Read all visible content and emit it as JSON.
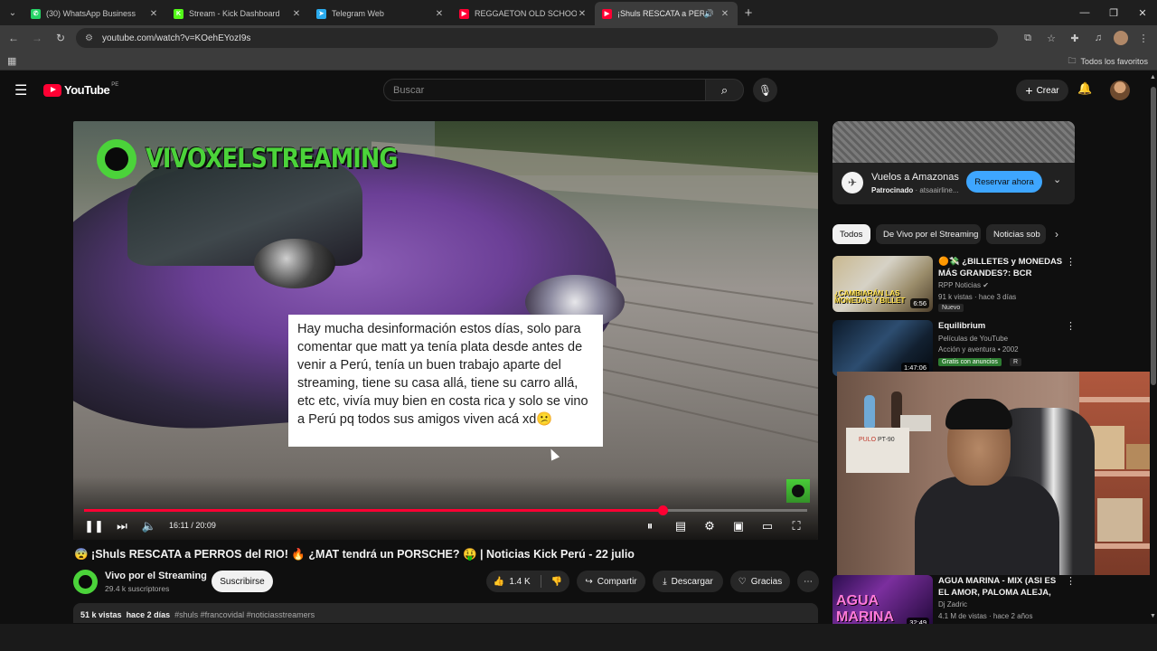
{
  "browser": {
    "tabs": [
      {
        "label": "(30) WhatsApp Business",
        "favicon_color": "#25d366",
        "favicon_glyph": "✆",
        "active": false
      },
      {
        "label": "Stream - Kick Dashboard",
        "favicon_color": "#53fc18",
        "favicon_glyph": "K",
        "active": false
      },
      {
        "label": "Telegram Web",
        "favicon_color": "#2aabee",
        "favicon_glyph": "➤",
        "active": false
      },
      {
        "label": "REGGAETON OLD SCHOOL SES",
        "favicon_color": "#ff0033",
        "favicon_glyph": "▶",
        "active": false
      },
      {
        "label": "¡Shuls RESCATA a PERR",
        "favicon_color": "#ff0033",
        "favicon_glyph": "▶",
        "active": true
      }
    ],
    "url": "youtube.com/watch?v=KOehEYozI9s",
    "bookmarks_folder": "Todos los favoritos"
  },
  "youtube": {
    "logo_text": "YouTube",
    "country_code": "PE",
    "search_placeholder": "Buscar",
    "create_label": "Crear"
  },
  "video": {
    "watermark": "VIVOXELSTREAMING",
    "comment_text": "Hay mucha desinformación estos días, solo para comentar que matt ya tenía plata desde antes de venir a Perú, tenía un buen trabajo aparte del streaming, tiene su casa allá, tiene su carro allá, etc etc, vivía muy bien en costa rica y solo se vino a Perú pq todos sus amigos viven acá xd😕",
    "time_display": "16:11 / 20:09",
    "progress_fraction": 0.8,
    "progress_color": "#ff0033",
    "title": "😨 ¡Shuls RESCATA a PERROS del RIO! 🔥 ¿MAT tendrá un PORSCHE? 🤑 | Noticias Kick Perú - 22 julio",
    "channel_name": "Vivo por el Streaming",
    "subscribers": "29.4 k suscriptores",
    "subscribe_label": "Suscribirse",
    "likes": "1.4 K",
    "share_label": "Compartir",
    "download_label": "Descargar",
    "thanks_label": "Gracias",
    "views": "51 k vistas",
    "date": "hace 2 días",
    "hashtags": "#shuls #francovidal #noticiasstreamers"
  },
  "ad": {
    "title": "Vuelos a Amazonas",
    "sponsored": "Patrocinado",
    "advertiser": "· atsaairline...",
    "cta": "Reservar ahora",
    "cta_color": "#3ea6ff"
  },
  "chips": [
    "Todos",
    "De Vivo por el Streaming",
    "Noticias sob"
  ],
  "recommendations": [
    {
      "title": "🟠💸 ¿BILLETES y MONEDAS MÁS GRANDES?: BCR advierte...",
      "channel": "RPP Noticias",
      "verified": true,
      "meta": "91 k vistas · hace 3 días",
      "badge": "Nuevo",
      "duration": "6:56",
      "thumb_caption": "¿CAMBIARÁN LAS MONEDAS Y BILLET"
    },
    {
      "title": "Equilibrium",
      "channel": "Películas de YouTube",
      "meta": "Acción y aventura • 2002",
      "badge": "Gratis con anuncios",
      "rating": "R",
      "duration": "1:47:06"
    },
    {
      "title": "AGUA MARINA - MIX (ASI ES EL AMOR, PALOMA ALEJA, BAST...",
      "channel": "Dj Zadric",
      "meta": "4.1 M de vistas · hace 2 años",
      "duration": "32:49",
      "thumb_caption": "AGUA MARINA"
    }
  ],
  "webcam": {
    "print_brand": "PULO",
    "print_model": "PT-90"
  }
}
